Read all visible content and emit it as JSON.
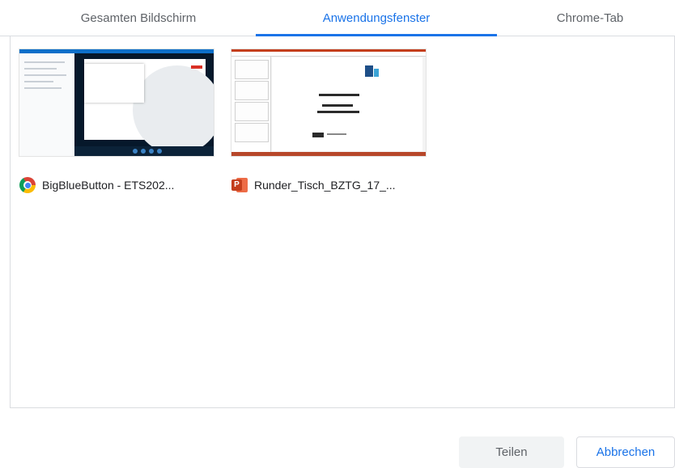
{
  "tabs": {
    "entire_screen": "Gesamten Bildschirm",
    "app_window": "Anwendungsfenster",
    "chrome_tab": "Chrome-Tab",
    "active": "app_window"
  },
  "sources": [
    {
      "title": "BigBlueButton - ETS202...",
      "icon": "chrome-icon"
    },
    {
      "title": "Runder_Tisch_BZTG_17_...",
      "icon": "powerpoint-icon"
    }
  ],
  "buttons": {
    "share": "Teilen",
    "cancel": "Abbrechen"
  },
  "colors": {
    "accent": "#1a73e8",
    "disabled_button_bg": "#f1f3f4"
  }
}
